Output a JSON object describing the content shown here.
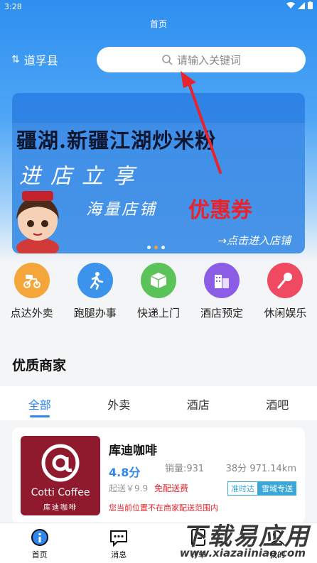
{
  "status_bar": {
    "time": "3:28"
  },
  "header": {
    "title": "首页",
    "location": "道孚县",
    "search_placeholder": "请输入关键词"
  },
  "banner": {
    "line1": "疆湖.新疆江湖炒米粉",
    "line2": "进店立享",
    "line3a": "海量店铺",
    "line3b": "优惠券",
    "cta": "→点击进入店铺"
  },
  "services": [
    {
      "label": "点达外卖",
      "icon": "delivery-scooter-icon",
      "color": "#f5a63a"
    },
    {
      "label": "跑腿办事",
      "icon": "running-person-icon",
      "color": "#3b93ec"
    },
    {
      "label": "快递上门",
      "icon": "package-box-icon",
      "color": "#5bc35a"
    },
    {
      "label": "酒店预定",
      "icon": "hotel-building-icon",
      "color": "#8b5de6"
    },
    {
      "label": "休闲娱乐",
      "icon": "microphone-icon",
      "color": "#f04a62"
    }
  ],
  "section_title": "优质商家",
  "tabs": [
    "全部",
    "外卖",
    "酒店",
    "酒吧"
  ],
  "merchant": {
    "logo_brand": "Cotti Coffee",
    "logo_brand_cn": "库迪咖啡",
    "name": "库迪咖啡",
    "rating": "4.8分",
    "sales": "销量:931",
    "eta": "38分 971.14km",
    "min_order": "起送￥9.9",
    "free_shipping": "免配送费",
    "badge_on_time": "准时达",
    "badge_express": "雪域专送",
    "notice": "您当前位置不在商家配送范围内"
  },
  "bottom_nav": [
    {
      "label": "首页",
      "icon": "home-info-icon"
    },
    {
      "label": "消息",
      "icon": "message-bubble-icon"
    },
    {
      "label": "订单",
      "icon": "order-list-icon"
    },
    {
      "label": "我的",
      "icon": "profile-icon"
    }
  ],
  "watermark": {
    "text_cn": "下载易应用",
    "url": "www.xiazaiiniao.com"
  },
  "colors": {
    "primary": "#2f86ec",
    "accent_red": "#e8232c",
    "brand_bg": "#8f1a2e"
  }
}
